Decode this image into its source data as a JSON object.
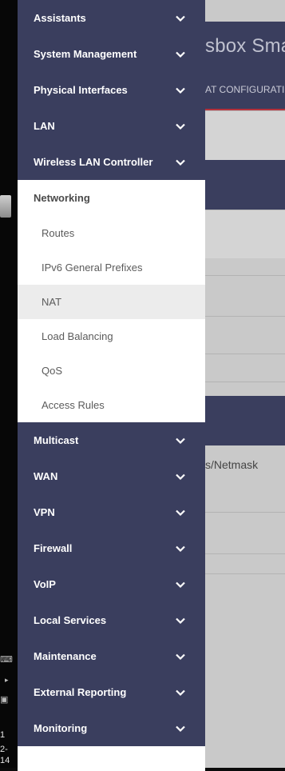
{
  "taskbar": {
    "clock_line1": "1",
    "clock_line2": "2-14"
  },
  "background_app": {
    "title_fragment": "sbox Sma",
    "subtitle_fragment": "AT CONFIGURATIO",
    "field_fragment": "s/Netmask"
  },
  "menu": {
    "top_categories": [
      {
        "label": "Assistants"
      },
      {
        "label": "System Management"
      },
      {
        "label": "Physical Interfaces"
      },
      {
        "label": "LAN"
      },
      {
        "label": "Wireless LAN Controller"
      }
    ],
    "expanded_group": {
      "label": "Networking",
      "items": [
        {
          "label": "Routes"
        },
        {
          "label": "IPv6 General Prefixes"
        },
        {
          "label": "NAT",
          "active": true
        },
        {
          "label": "Load Balancing"
        },
        {
          "label": "QoS"
        },
        {
          "label": "Access Rules"
        }
      ]
    },
    "bottom_categories": [
      {
        "label": "Multicast"
      },
      {
        "label": "WAN"
      },
      {
        "label": "VPN"
      },
      {
        "label": "Firewall"
      },
      {
        "label": "VoIP"
      },
      {
        "label": "Local Services"
      },
      {
        "label": "Maintenance"
      },
      {
        "label": "External Reporting"
      },
      {
        "label": "Monitoring"
      }
    ],
    "category_icon": "chevron-down-icon"
  },
  "colors": {
    "menu_header_bg": "#3a3e5e",
    "menu_item_bg": "#ffffff",
    "active_item_bg": "#ececec",
    "accent_red": "#b5323c"
  }
}
